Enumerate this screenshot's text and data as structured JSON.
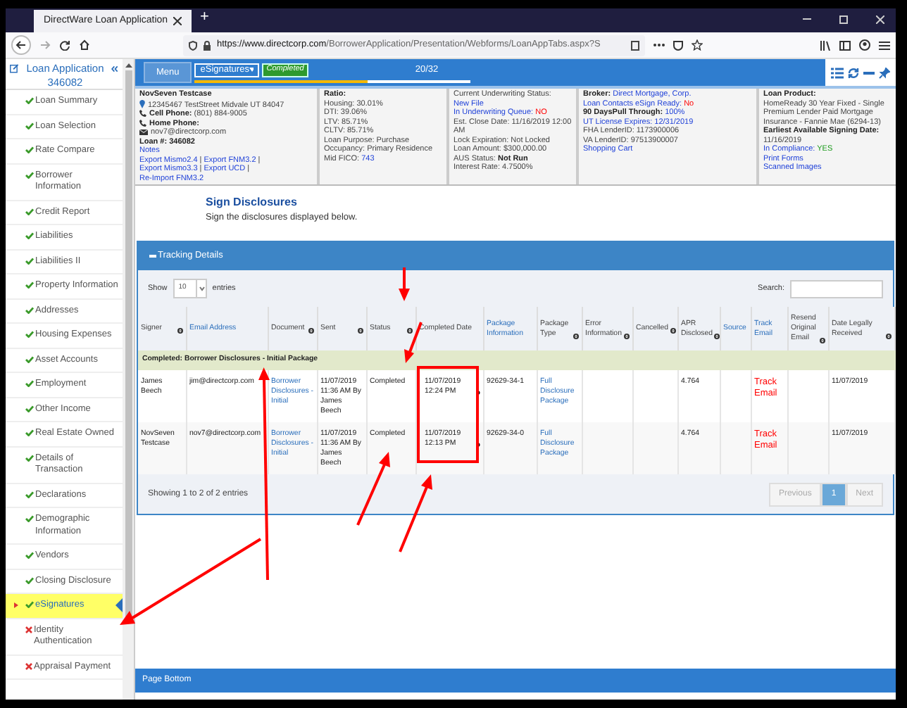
{
  "browser": {
    "tab_title": "DirectWare Loan Application",
    "new_tab": "+",
    "url_host": "https://www.directcorp.com",
    "url_path": "/BorrowerApplication/Presentation/Webforms/LoanAppTabs.aspx?S"
  },
  "sidebar": {
    "title": "Loan Application 346082",
    "items": [
      {
        "label": "Loan Summary",
        "complete": true,
        "selected": false
      },
      {
        "label": "Loan Selection",
        "complete": true,
        "selected": false
      },
      {
        "label": "Rate Compare",
        "complete": true,
        "selected": false
      },
      {
        "label": "Borrower Information",
        "complete": true,
        "selected": false
      },
      {
        "label": "Credit Report",
        "complete": true,
        "selected": false
      },
      {
        "label": "Liabilities",
        "complete": true,
        "selected": false
      },
      {
        "label": "Liabilities II",
        "complete": true,
        "selected": false
      },
      {
        "label": "Property Information",
        "complete": true,
        "selected": false
      },
      {
        "label": "Addresses",
        "complete": true,
        "selected": false
      },
      {
        "label": "Housing Expenses",
        "complete": true,
        "selected": false
      },
      {
        "label": "Asset Accounts",
        "complete": true,
        "selected": false
      },
      {
        "label": "Employment",
        "complete": true,
        "selected": false
      },
      {
        "label": "Other Income",
        "complete": true,
        "selected": false
      },
      {
        "label": "Real Estate Owned",
        "complete": true,
        "selected": false
      },
      {
        "label": "Details of Transaction",
        "complete": true,
        "selected": false
      },
      {
        "label": "Declarations",
        "complete": true,
        "selected": false
      },
      {
        "label": "Demographic Information",
        "complete": true,
        "selected": false
      },
      {
        "label": "Vendors",
        "complete": true,
        "selected": false
      },
      {
        "label": "Closing Disclosure",
        "complete": true,
        "selected": false
      },
      {
        "label": "eSignatures",
        "complete": true,
        "selected": true
      },
      {
        "label": "Identity Authentication",
        "complete": false,
        "selected": false
      },
      {
        "label": "Appraisal Payment",
        "complete": false,
        "selected": false
      }
    ]
  },
  "toolbar": {
    "menu": "Menu",
    "dropdown": "eSignatures",
    "badge": "Completed",
    "progress_text": "20/32",
    "level": 0.625
  },
  "info_columns": [
    [
      {
        "kind": "text",
        "parts": [
          {
            "t": "NovSeven Testcase",
            "kind": "bold"
          }
        ]
      },
      {
        "kind": "address",
        "parts": [
          {
            "t": "12345467 TestStreet Midvale UT 84047",
            "kind": "plain"
          }
        ]
      },
      {
        "kind": "phone",
        "parts": [
          {
            "t": "Cell Phone:",
            "kind": "bold"
          },
          {
            "t": "(801) 884-9005",
            "kind": "plain"
          }
        ]
      },
      {
        "kind": "phone",
        "parts": [
          {
            "t": "Home Phone:",
            "kind": "bold"
          }
        ]
      },
      {
        "kind": "email",
        "parts": [
          {
            "t": "nov7@directcorp.com",
            "kind": "plain"
          }
        ]
      },
      {
        "kind": "text",
        "parts": [
          {
            "t": "Loan #: 346082",
            "kind": "bold"
          }
        ]
      },
      {
        "kind": "text",
        "parts": [
          {
            "t": "Notes",
            "kind": "link"
          }
        ]
      },
      {
        "kind": "text",
        "parts": [
          {
            "t": "Export Mismo2.4",
            "kind": "link"
          },
          {
            "t": "|",
            "kind": "plain"
          },
          {
            "t": "Export FNM3.2",
            "kind": "link"
          },
          {
            "t": "|",
            "kind": "plain"
          },
          {
            "t": "Export Mismo3.3",
            "kind": "link"
          },
          {
            "t": "|",
            "kind": "plain"
          },
          {
            "t": "Export UCD",
            "kind": "link"
          },
          {
            "t": "|",
            "kind": "plain"
          },
          {
            "t": "Re-Import FNM3.2",
            "kind": "link"
          }
        ]
      }
    ],
    [
      {
        "kind": "text",
        "parts": [
          {
            "t": "Ratio:",
            "kind": "bold"
          }
        ]
      },
      {
        "kind": "text",
        "parts": [
          {
            "t": "Housing: 30.01%",
            "kind": "plain"
          }
        ]
      },
      {
        "kind": "text",
        "parts": [
          {
            "t": "DTI: 39.06%",
            "kind": "plain"
          }
        ]
      },
      {
        "kind": "text",
        "parts": [
          {
            "t": "LTV: 85.71%",
            "kind": "plain"
          }
        ]
      },
      {
        "kind": "text",
        "parts": [
          {
            "t": "CLTV: 85.71%",
            "kind": "plain"
          }
        ]
      },
      {
        "kind": "text",
        "parts": [
          {
            "t": "Loan Purpose: Purchase",
            "kind": "plain"
          }
        ]
      },
      {
        "kind": "text",
        "parts": [
          {
            "t": "Occupancy: Primary Residence",
            "kind": "plain"
          }
        ]
      },
      {
        "kind": "text",
        "parts": [
          {
            "t": "Mid FICO:",
            "kind": "plain"
          },
          {
            "t": "743",
            "kind": "link"
          }
        ]
      }
    ],
    [
      {
        "kind": "text",
        "parts": [
          {
            "t": "Current Underwriting Status:",
            "kind": "plain"
          },
          {
            "t": "New File",
            "kind": "link"
          }
        ]
      },
      {
        "kind": "text",
        "parts": [
          {
            "t": "In Underwriting Queue:",
            "kind": "link"
          },
          {
            "t": "NO",
            "kind": "negative"
          }
        ]
      },
      {
        "kind": "text",
        "parts": [
          {
            "t": "Est. Close Date: 11/16/2019 12:00 AM",
            "kind": "plain"
          }
        ]
      },
      {
        "kind": "text",
        "parts": [
          {
            "t": "Lock Expiration: Not Locked",
            "kind": "plain"
          }
        ]
      },
      {
        "kind": "text",
        "parts": [
          {
            "t": "Loan Amount: $300,000.00",
            "kind": "plain"
          }
        ]
      },
      {
        "kind": "text",
        "parts": [
          {
            "t": "AUS Status:",
            "kind": "plain"
          },
          {
            "t": "Not Run",
            "kind": "bold"
          }
        ]
      },
      {
        "kind": "text",
        "parts": [
          {
            "t": "Interest Rate: 4.7500%",
            "kind": "plain"
          }
        ]
      }
    ],
    [
      {
        "kind": "text",
        "parts": [
          {
            "t": "Broker:",
            "kind": "bold"
          },
          {
            "t": "Direct Mortgage, Corp.",
            "kind": "link"
          }
        ]
      },
      {
        "kind": "text",
        "parts": [
          {
            "t": "Loan Contacts eSign Ready:",
            "kind": "link"
          },
          {
            "t": "No",
            "kind": "negative"
          }
        ]
      },
      {
        "kind": "text",
        "parts": [
          {
            "t": "90 DaysPull Through:",
            "kind": "bold"
          },
          {
            "t": "100%",
            "kind": "link"
          }
        ]
      },
      {
        "kind": "text",
        "parts": [
          {
            "t": "UT License Expires: 12/31/2019",
            "kind": "link"
          }
        ]
      },
      {
        "kind": "text",
        "parts": [
          {
            "t": "FHA LenderID: 1173900006",
            "kind": "plain"
          }
        ]
      },
      {
        "kind": "text",
        "parts": [
          {
            "t": "VA LenderID: 97513900007",
            "kind": "plain"
          }
        ]
      },
      {
        "kind": "text",
        "parts": [
          {
            "t": "Shopping Cart",
            "kind": "link"
          }
        ]
      }
    ],
    [
      {
        "kind": "text",
        "parts": [
          {
            "t": "Loan Product:",
            "kind": "bold"
          }
        ]
      },
      {
        "kind": "text",
        "parts": [
          {
            "t": "HomeReady 30 Year Fixed - Single Premium Lender Paid Mortgage Insurance - Fannie Mae (6294-13)",
            "kind": "plain"
          }
        ]
      },
      {
        "kind": "text",
        "parts": [
          {
            "t": "Earliest Available Signing Date:",
            "kind": "bold"
          }
        ]
      },
      {
        "kind": "text",
        "parts": [
          {
            "t": "11/16/2019",
            "kind": "plain"
          }
        ]
      },
      {
        "kind": "text",
        "parts": [
          {
            "t": "In Compliance:",
            "kind": "link"
          },
          {
            "t": "YES",
            "kind": "positive"
          }
        ]
      },
      {
        "kind": "text",
        "parts": [
          {
            "t": "Print Forms",
            "kind": "link"
          }
        ]
      },
      {
        "kind": "text",
        "parts": [
          {
            "t": "Scanned Images",
            "kind": "link"
          }
        ]
      }
    ]
  ],
  "section": {
    "title": "Sign Disclosures",
    "subtitle": "Sign the disclosures displayed below."
  },
  "tracking": {
    "title": "Tracking Details",
    "show_label": "Show",
    "page_size": "10",
    "entries_label": "entries",
    "search_label": "Search:",
    "columns": [
      {
        "label": "Signer",
        "link": false,
        "sortable": true,
        "kind": "plain"
      },
      {
        "label": "Email Address",
        "link": true,
        "sortable": false,
        "kind": "plain"
      },
      {
        "label": "Document",
        "link": false,
        "sortable": true,
        "kind": "link"
      },
      {
        "label": "Sent",
        "link": false,
        "sortable": true,
        "kind": "plain"
      },
      {
        "label": "Status",
        "link": false,
        "sortable": true,
        "kind": "plain"
      },
      {
        "label": "Completed Date",
        "link": false,
        "sortable": false,
        "kind": "info"
      },
      {
        "label": "Package Information",
        "link": true,
        "sortable": false,
        "kind": "plain"
      },
      {
        "label": "Package Type",
        "link": false,
        "sortable": true,
        "kind": "link"
      },
      {
        "label": "Error Information",
        "link": false,
        "sortable": true,
        "kind": "plain"
      },
      {
        "label": "Cancelled",
        "link": false,
        "sortable": true,
        "kind": "plain"
      },
      {
        "label": "APR Disclosed",
        "link": false,
        "sortable": true,
        "kind": "plain"
      },
      {
        "label": "Source",
        "link": true,
        "sortable": false,
        "kind": "plain"
      },
      {
        "label": "Track Email",
        "link": true,
        "sortable": false,
        "kind": "alert"
      },
      {
        "label": "Resend Original Email",
        "link": false,
        "sortable": true,
        "kind": "plain"
      },
      {
        "label": "Date Legally Received",
        "link": false,
        "sortable": true,
        "kind": "plain"
      }
    ],
    "group": "Completed: Borrower Disclosures - Initial Package",
    "rows": [
      {
        "cells": [
          "James Beech",
          "jim@directcorp.com",
          "Borrower Disclosures - Initial",
          "11/07/2019 11:36 AM By James Beech",
          "Completed",
          "11/07/2019 12:24 PM",
          "92629-34-1",
          "Full Disclosure Package",
          null,
          null,
          "4.764",
          null,
          "Track Email",
          null,
          "11/07/2019"
        ]
      },
      {
        "cells": [
          "NovSeven Testcase",
          "nov7@directcorp.com",
          "Borrower Disclosures - Initial",
          "11/07/2019 11:36 AM By James Beech",
          "Completed",
          "11/07/2019 12:13 PM",
          "92629-34-0",
          "Full Disclosure Package",
          null,
          null,
          "4.764",
          null,
          "Track Email",
          null,
          "11/07/2019"
        ]
      }
    ],
    "summary": "Showing 1 to 2 of 2 entries",
    "pages": [
      {
        "label": "Previous",
        "selected": false,
        "disabled": true
      },
      {
        "label": "1",
        "selected": true,
        "disabled": false
      },
      {
        "label": "Next",
        "selected": false,
        "disabled": true
      }
    ]
  },
  "page_bottom": "Page Bottom"
}
